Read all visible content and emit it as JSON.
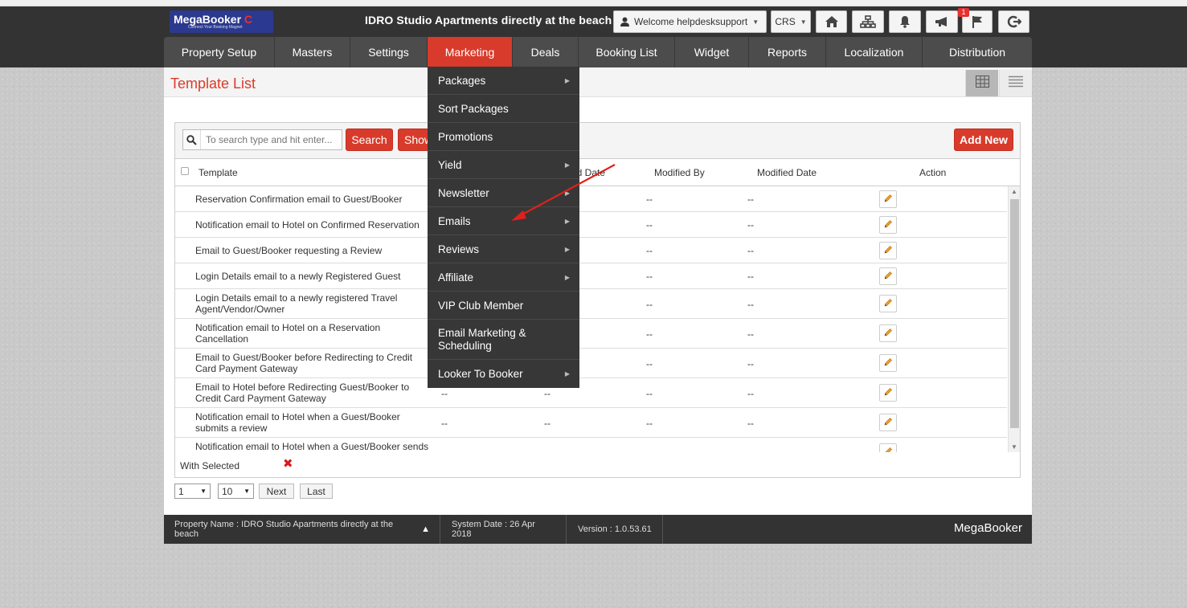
{
  "header": {
    "logo_brand": "MegaBooker",
    "logo_tagline": "Connect Your Booking Magnet",
    "property_title": "IDRO Studio Apartments directly at the beach",
    "welcome_label": "Welcome helpdesksupport",
    "crs_label": "CRS",
    "notification_count": "1",
    "icons": [
      "home-icon",
      "sitemap-icon",
      "bell-icon",
      "megaphone-icon",
      "flag-icon",
      "logout-icon"
    ]
  },
  "nav": {
    "items": [
      "Property Setup",
      "Masters",
      "Settings",
      "Marketing",
      "Deals",
      "Booking List",
      "Widget",
      "Reports",
      "Localization",
      "Distribution"
    ],
    "active": "Marketing"
  },
  "marketing_menu": {
    "items": [
      {
        "label": "Packages",
        "has_sub": true
      },
      {
        "label": "Sort Packages",
        "has_sub": false
      },
      {
        "label": "Promotions",
        "has_sub": false
      },
      {
        "label": "Yield",
        "has_sub": true
      },
      {
        "label": "Newsletter",
        "has_sub": true
      },
      {
        "label": "Emails",
        "has_sub": true
      },
      {
        "label": "Reviews",
        "has_sub": true
      },
      {
        "label": "Affiliate",
        "has_sub": true
      },
      {
        "label": "VIP Club Member",
        "has_sub": false
      },
      {
        "label": "Email Marketing & Scheduling",
        "has_sub": false
      },
      {
        "label": "Looker To Booker",
        "has_sub": true
      }
    ]
  },
  "page": {
    "title": "Template List"
  },
  "toolbar": {
    "search_placeholder": "To search type and hit enter...",
    "search_label": "Search",
    "show_label": "Show",
    "add_new_label": "Add New"
  },
  "table": {
    "columns": {
      "template": "Template",
      "created_date_partial": "ed Date",
      "modified_by": "Modified By",
      "modified_date": "Modified Date",
      "action": "Action"
    },
    "rows": [
      {
        "template": "Reservation Confirmation email to Guest/Booker",
        "created_by": "",
        "created_date": "",
        "modified_by": "--",
        "modified_date": "--"
      },
      {
        "template": "Notification email to Hotel on Confirmed Reservation",
        "created_by": "",
        "created_date": "",
        "modified_by": "--",
        "modified_date": "--"
      },
      {
        "template": "Email to Guest/Booker requesting a Review",
        "created_by": "",
        "created_date": "",
        "modified_by": "--",
        "modified_date": "--"
      },
      {
        "template": "Login Details email to a newly Registered Guest",
        "created_by": "",
        "created_date": "",
        "modified_by": "--",
        "modified_date": "--"
      },
      {
        "template": "Login Details email to a newly registered Travel Agent/Vendor/Owner",
        "created_by": "",
        "created_date": "",
        "modified_by": "--",
        "modified_date": "--"
      },
      {
        "template": "Notification email to Hotel on a Reservation Cancellation",
        "created_by": "",
        "created_date": "",
        "modified_by": "--",
        "modified_date": "--"
      },
      {
        "template": "Email to Guest/Booker before Redirecting to Credit Card Payment Gateway",
        "created_by": "",
        "created_date": "",
        "modified_by": "--",
        "modified_date": "--"
      },
      {
        "template": "Email to Hotel before Redirecting Guest/Booker to Credit Card Payment Gateway",
        "created_by": "--",
        "created_date": "--",
        "modified_by": "--",
        "modified_date": "--"
      },
      {
        "template": "Notification email to Hotel when a Guest/Booker submits a review",
        "created_by": "--",
        "created_date": "--",
        "modified_by": "--",
        "modified_date": "--"
      },
      {
        "template": "Notification email to Hotel when a Guest/Booker sends",
        "created_by": "--",
        "created_date": "--",
        "modified_by": "--",
        "modified_date": "--"
      }
    ],
    "with_selected_label": "With Selected"
  },
  "pagination": {
    "page_value": "1",
    "page_size_value": "10",
    "next_label": "Next",
    "last_label": "Last"
  },
  "footer": {
    "property_name": "Property Name : IDRO Studio Apartments directly at the beach",
    "system_date": "System Date : 26 Apr 2018",
    "version": "Version : 1.0.53.61",
    "brand": "MegaBooker"
  },
  "colors": {
    "accent_red": "#d83b2b",
    "header_dark": "#333333",
    "nav_bg": "#4c4c4c",
    "menu_bg": "#373737"
  }
}
